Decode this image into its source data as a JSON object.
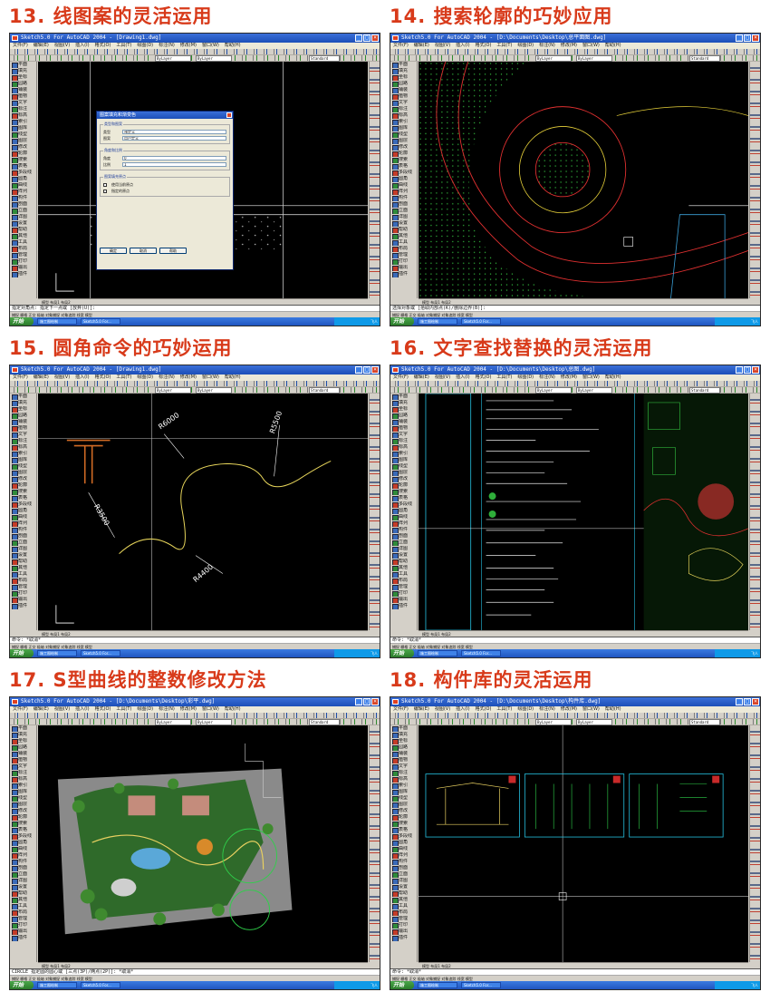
{
  "colors": {
    "title_red": "#d83a1a",
    "xp_blue": "#1c4fb8",
    "cad_background": "#000000",
    "panel_gray": "#d4d0c8"
  },
  "panels": [
    {
      "title": "13. 线图案的灵活运用",
      "window_title": "Sketch5.0 For AutoCAD 2004 - [Drawing1.dwg]",
      "command_line": "指定对角点: 指定下一点或 [放弃(U)]:",
      "dialog": {
        "title": "图案填充和渐变色",
        "group_type": "类型和图案",
        "row_type_label": "类型",
        "row_type_value": "预定义",
        "row_pattern_label": "图案",
        "row_pattern_value": "用户定义",
        "group_angle": "角度和比例",
        "row_angle_label": "角度",
        "row_angle_value": "0",
        "row_scale_label": "比例",
        "row_scale_value": "1",
        "group_origin": "图案填充原点",
        "option_current": "使用当前原点",
        "option_specified": "指定的原点",
        "btn_ok": "确定",
        "btn_cancel": "取消",
        "btn_help": "帮助"
      }
    },
    {
      "title": "14. 搜索轮廓的巧妙应用",
      "window_title": "Sketch5.0 For AutoCAD 2004 - [D:\\Documents\\Desktop\\总平面图.dwg]",
      "command_line": "选择对象或 [拾取内部点(K)/删除边界(B)]:",
      "tab_label": "总平面图"
    },
    {
      "title": "15. 圆角命令的巧妙运用",
      "window_title": "Sketch5.0 For AutoCAD 2004 - [Drawing1.dwg]",
      "command_line": "命令: *取消*",
      "labels": [
        "R6000",
        "R3500",
        "R5500",
        "R4400"
      ]
    },
    {
      "title": "16. 文字查找替换的灵活运用",
      "window_title": "Sketch5.0 For AutoCAD 2004 - [D:\\Documents\\Desktop\\总图.dwg]",
      "command_line": "命令: *取消*"
    },
    {
      "title": "17. S型曲线的整数修改方法",
      "window_title": "Sketch5.0 For AutoCAD 2004 - [D:\\Documents\\Desktop\\彩平.dwg]",
      "command_line": "CIRCLE 指定圆的圆心或 [三点(3P)/两点(2P)]: *取消*"
    },
    {
      "title": "18. 构件库的灵活运用",
      "window_title": "Sketch5.0 For AutoCAD 2004 - [D:\\Documents\\Desktop\\构件库.dwg]",
      "command_line": "命令: *取消*"
    }
  ],
  "common": {
    "menu": [
      "文件(F)",
      "编辑(E)",
      "视图(V)",
      "插入(I)",
      "格式(O)",
      "工具(T)",
      "绘图(D)",
      "标注(N)",
      "修改(M)",
      "窗口(W)",
      "帮助(H)"
    ],
    "left_panel_items": [
      "平面",
      "填充",
      "坐标",
      "园路",
      "铺装",
      "植物",
      "文字",
      "标注",
      "标高",
      "索引",
      "图库",
      "线型",
      "图层",
      "修改",
      "轮廓",
      "搜索",
      "表格",
      "多段线",
      "圆角",
      "曲线",
      "阵列",
      "构件",
      "剖面",
      "立面",
      "详图",
      "设置",
      "帮助",
      "其他",
      "工具",
      "布局",
      "管理",
      "打印",
      "输出",
      "插件"
    ],
    "combo_layer": "ByLayer",
    "combo_style": "Standard",
    "layout_tabs": "模型 布局1 布局2",
    "status_bar": "捕捉 栅格 正交 极轴 对象捕捉 对象追踪 线宽 模型",
    "start_label": "开始",
    "taskbar_item_1": "施工图绘制",
    "taskbar_item_2": "Sketch5.0 For...",
    "tray_label": "飞人"
  }
}
